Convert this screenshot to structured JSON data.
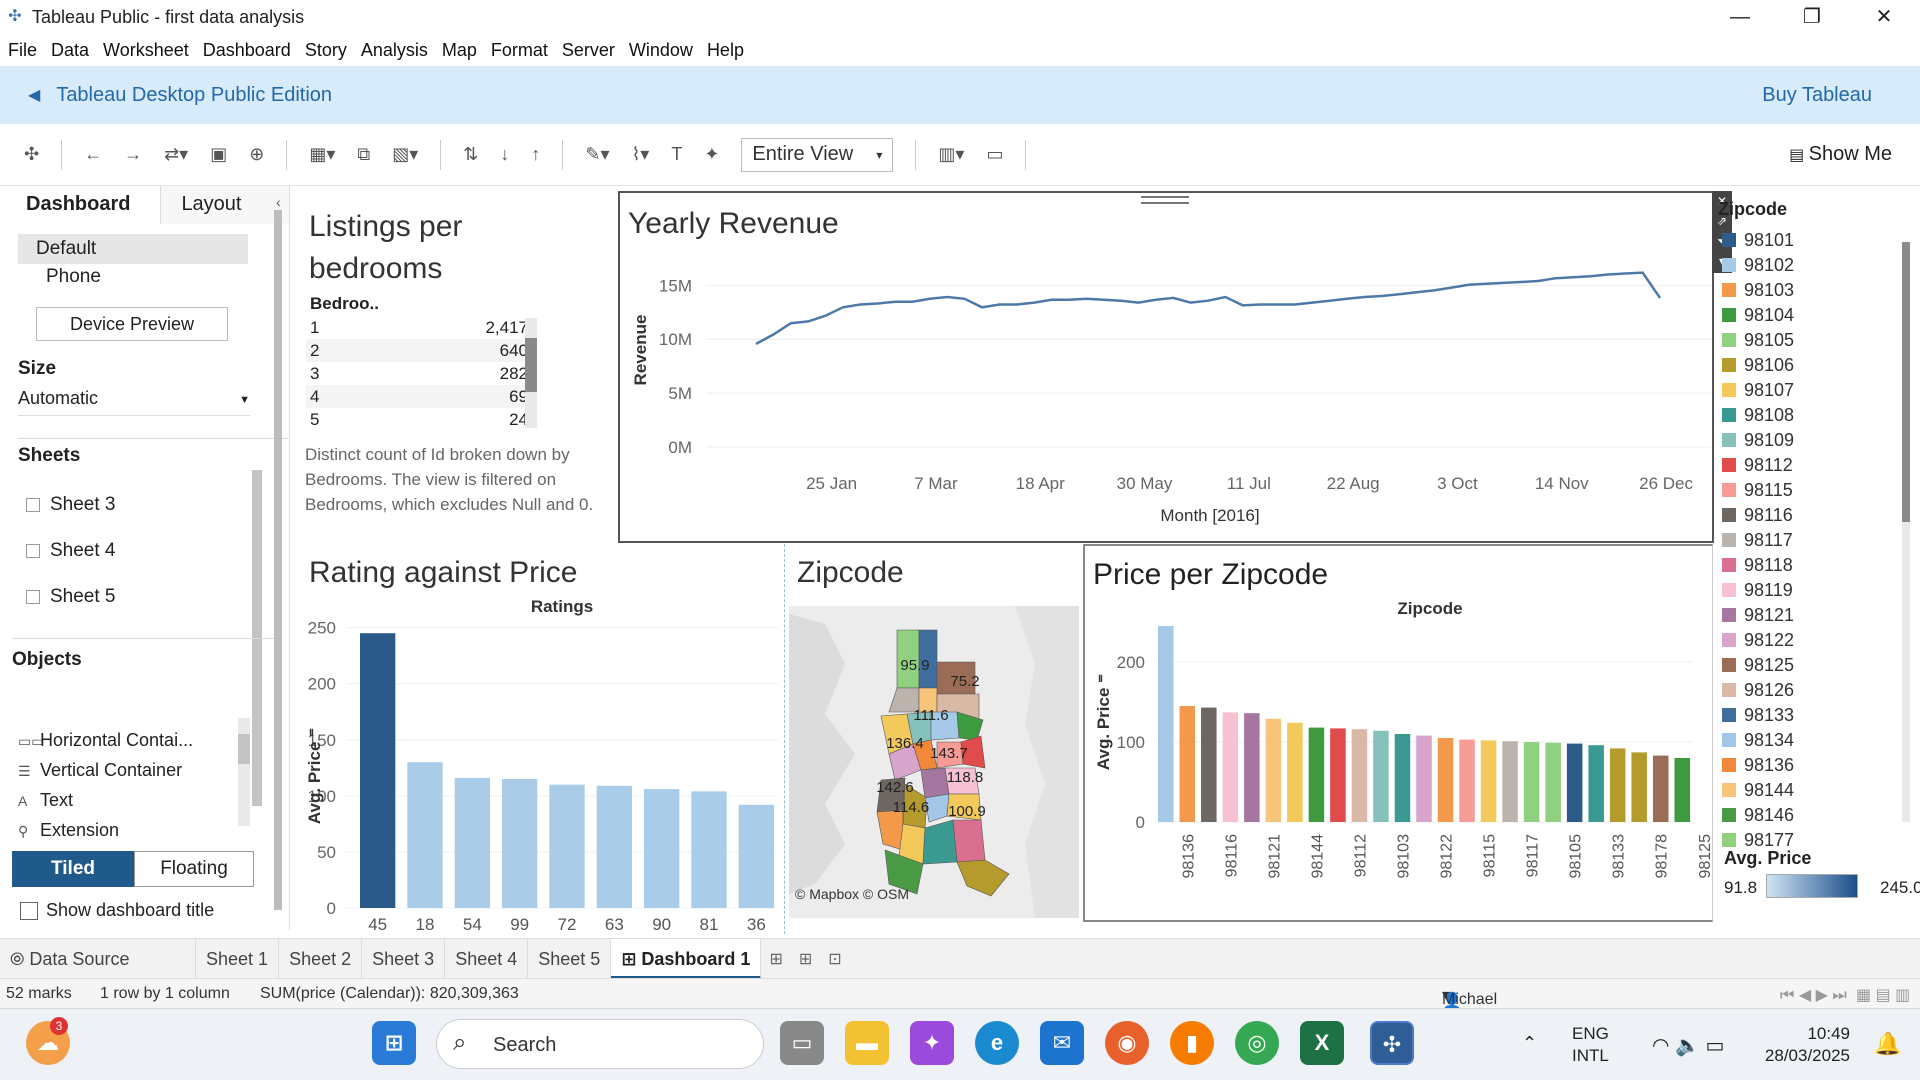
{
  "window": {
    "title": "Tableau Public - first data analysis",
    "minimize": "—",
    "maximize": "❐",
    "close": "✕"
  },
  "menu": [
    "File",
    "Data",
    "Worksheet",
    "Dashboard",
    "Story",
    "Analysis",
    "Map",
    "Format",
    "Server",
    "Window",
    "Help"
  ],
  "banner": {
    "edition": "Tableau Desktop Public Edition",
    "buy": "Buy Tableau"
  },
  "toolbar": {
    "fit": "Entire View",
    "show_me": "Show Me"
  },
  "left_pane": {
    "tabs": [
      "Dashboard",
      "Layout"
    ],
    "devices": [
      "Default",
      "Phone"
    ],
    "device_preview": "Device Preview",
    "size_label": "Size",
    "size_value": "Automatic",
    "sheets_label": "Sheets",
    "sheets": [
      "Sheet 3",
      "Sheet 4",
      "Sheet 5"
    ],
    "objects_label": "Objects",
    "objects": [
      "Horizontal Contai...",
      "Vertical Container",
      "Text",
      "Extension"
    ],
    "tiled": "Tiled",
    "floating": "Floating",
    "show_title": "Show dashboard title"
  },
  "listings": {
    "title": "Listings per bedrooms",
    "column": "Bedroo..",
    "rows": [
      {
        "k": "1",
        "v": "2,417"
      },
      {
        "k": "2",
        "v": "640"
      },
      {
        "k": "3",
        "v": "282"
      },
      {
        "k": "4",
        "v": "69"
      },
      {
        "k": "5",
        "v": "24"
      }
    ],
    "description": "Distinct count of Id broken down by Bedrooms. The view is filtered on Bedrooms, which excludes Null and 0."
  },
  "yearly": {
    "title": "Yearly Revenue"
  },
  "rating": {
    "title": "Rating against Price"
  },
  "zipmap": {
    "title": "Zipcode",
    "credit": "© Mapbox © OSM",
    "labels": [
      "95.9",
      "75.2",
      "111.6",
      "136.4",
      "143.7",
      "118.8",
      "142.6",
      "114.6",
      "100.9"
    ]
  },
  "pricezip": {
    "title": "Price per Zipcode"
  },
  "legend": {
    "title": "Zipcode",
    "items": [
      {
        "zip": "98101",
        "color": "#2e5c8a"
      },
      {
        "zip": "98102",
        "color": "#a6c9e8"
      },
      {
        "zip": "98103",
        "color": "#f29a4a"
      },
      {
        "zip": "98104",
        "color": "#3e9a3e"
      },
      {
        "zip": "98105",
        "color": "#8fd17e"
      },
      {
        "zip": "98106",
        "color": "#b59a2c"
      },
      {
        "zip": "98107",
        "color": "#f2c95a"
      },
      {
        "zip": "98108",
        "color": "#3a9a92"
      },
      {
        "zip": "98109",
        "color": "#86c2bb"
      },
      {
        "zip": "98112",
        "color": "#e04b4b"
      },
      {
        "zip": "98115",
        "color": "#f79b96"
      },
      {
        "zip": "98116",
        "color": "#6e6661"
      },
      {
        "zip": "98117",
        "color": "#bdb3ad"
      },
      {
        "zip": "98118",
        "color": "#d9708f"
      },
      {
        "zip": "98119",
        "color": "#f7c1d3"
      },
      {
        "zip": "98121",
        "color": "#a577a0"
      },
      {
        "zip": "98122",
        "color": "#d7a5cc"
      },
      {
        "zip": "98125",
        "color": "#9b6d57"
      },
      {
        "zip": "98126",
        "color": "#d9b8a6"
      },
      {
        "zip": "98133",
        "color": "#3f6d9e"
      },
      {
        "zip": "98134",
        "color": "#a2c6e6"
      },
      {
        "zip": "98136",
        "color": "#f2893a"
      },
      {
        "zip": "98144",
        "color": "#f7c57a"
      },
      {
        "zip": "98146",
        "color": "#4a9a45"
      },
      {
        "zip": "98177",
        "color": "#8fd17e"
      }
    ],
    "avg_title": "Avg. Price",
    "avg_min": "91.8",
    "avg_max": "245.0"
  },
  "sheet_tabs": [
    "Data Source",
    "Sheet 1",
    "Sheet 2",
    "Sheet 3",
    "Sheet 4",
    "Sheet 5",
    "Dashboard 1"
  ],
  "status": {
    "marks": "52 marks",
    "rows": "1 row by 1 column",
    "sum": "SUM(price (Calendar)): 820,309,363",
    "user": "Michael Fadairo"
  },
  "taskbar": {
    "search": "Search",
    "lang1": "ENG",
    "lang2": "INTL",
    "time": "10:49",
    "date": "28/03/2025",
    "badge": "3"
  },
  "chart_data": [
    {
      "type": "line",
      "title": "Yearly Revenue",
      "xlabel": "Month [2016]",
      "ylabel": "Revenue",
      "x_ticks": [
        "25 Jan",
        "7 Mar",
        "18 Apr",
        "30 May",
        "11 Jul",
        "22 Aug",
        "3 Oct",
        "14 Nov",
        "26 Dec"
      ],
      "y_ticks": [
        "0M",
        "5M",
        "10M",
        "15M"
      ],
      "ylim": [
        0,
        18000000
      ],
      "series": [
        {
          "x": [
            0,
            7,
            14,
            21,
            28,
            35,
            42,
            49,
            56,
            63,
            70,
            77,
            84,
            91,
            98,
            105,
            112,
            119,
            126,
            133,
            140,
            147,
            154,
            161,
            168,
            175,
            182,
            189,
            196,
            203,
            210,
            217,
            224,
            231,
            238,
            245,
            252,
            259,
            266,
            273,
            280,
            287,
            294,
            301,
            308,
            315,
            322,
            329,
            336,
            343,
            350,
            357,
            364
          ],
          "y": [
            11.0,
            12.0,
            13.2,
            13.4,
            14.0,
            14.9,
            15.2,
            15.3,
            15.5,
            15.5,
            15.8,
            16.0,
            15.8,
            14.9,
            15.2,
            15.2,
            15.4,
            15.7,
            15.7,
            15.8,
            15.7,
            15.6,
            15.4,
            15.7,
            15.9,
            15.4,
            15.6,
            16.0,
            15.1,
            15.2,
            15.2,
            15.2,
            15.4,
            15.6,
            15.8,
            16.0,
            16.1,
            16.3,
            16.5,
            16.7,
            17.0,
            17.3,
            17.4,
            17.5,
            17.6,
            17.7,
            18.0,
            18.1,
            18.2,
            18.4,
            18.5,
            18.6,
            15.9
          ]
        }
      ]
    },
    {
      "type": "bar",
      "title": "Ratings",
      "ylabel": "Avg. Price",
      "categories": [
        "45",
        "18",
        "54",
        "99",
        "72",
        "63",
        "90",
        "81",
        "36"
      ],
      "values": [
        245,
        130,
        116,
        115,
        110,
        109,
        106,
        104,
        92
      ],
      "y_ticks": [
        0,
        50,
        100,
        150,
        200,
        250
      ],
      "ylim": [
        0,
        255
      ]
    },
    {
      "type": "bar",
      "title": "Zipcode",
      "ylabel": "Avg. Price",
      "categories": [
        "98134",
        "98136",
        "98116",
        "98119",
        "98121",
        "98144",
        "98107",
        "98146",
        "98112",
        "98126",
        "98103",
        "98108",
        "98122",
        "98136",
        "98115",
        "98107",
        "98117",
        "98105",
        "98105",
        "98133",
        "98125",
        "98178",
        "98106",
        "98125",
        "98146"
      ],
      "tick_labels": [
        "98136",
        "98116",
        "98121",
        "98144",
        "98112",
        "98103",
        "98122",
        "98115",
        "98117",
        "98105",
        "98133",
        "98178",
        "98125"
      ],
      "values": [
        245,
        145,
        143,
        137,
        136,
        129,
        124,
        118,
        117,
        116,
        114,
        110,
        108,
        105,
        103,
        102,
        101,
        100,
        99,
        98,
        96,
        92,
        87,
        83,
        80,
        76
      ],
      "colors": [
        "#a6c9e8",
        "#f29a4a",
        "#6e6661",
        "#f7c1d3",
        "#a577a0",
        "#f7c57a",
        "#f2c95a",
        "#3e9a3e",
        "#e04b4b",
        "#d9b8a6",
        "#86c2bb",
        "#3a9a92",
        "#d7a5cc",
        "#f29a4a",
        "#f79b96",
        "#f2c95a",
        "#bdb3ad",
        "#8fd17e",
        "#8fd17e",
        "#2e5c8a",
        "#3a9a92",
        "#b59a2c",
        "#b59a2c",
        "#9b6d57",
        "#3e9a3e"
      ],
      "y_ticks": [
        0,
        100,
        200
      ],
      "ylim": [
        0,
        250
      ]
    }
  ]
}
